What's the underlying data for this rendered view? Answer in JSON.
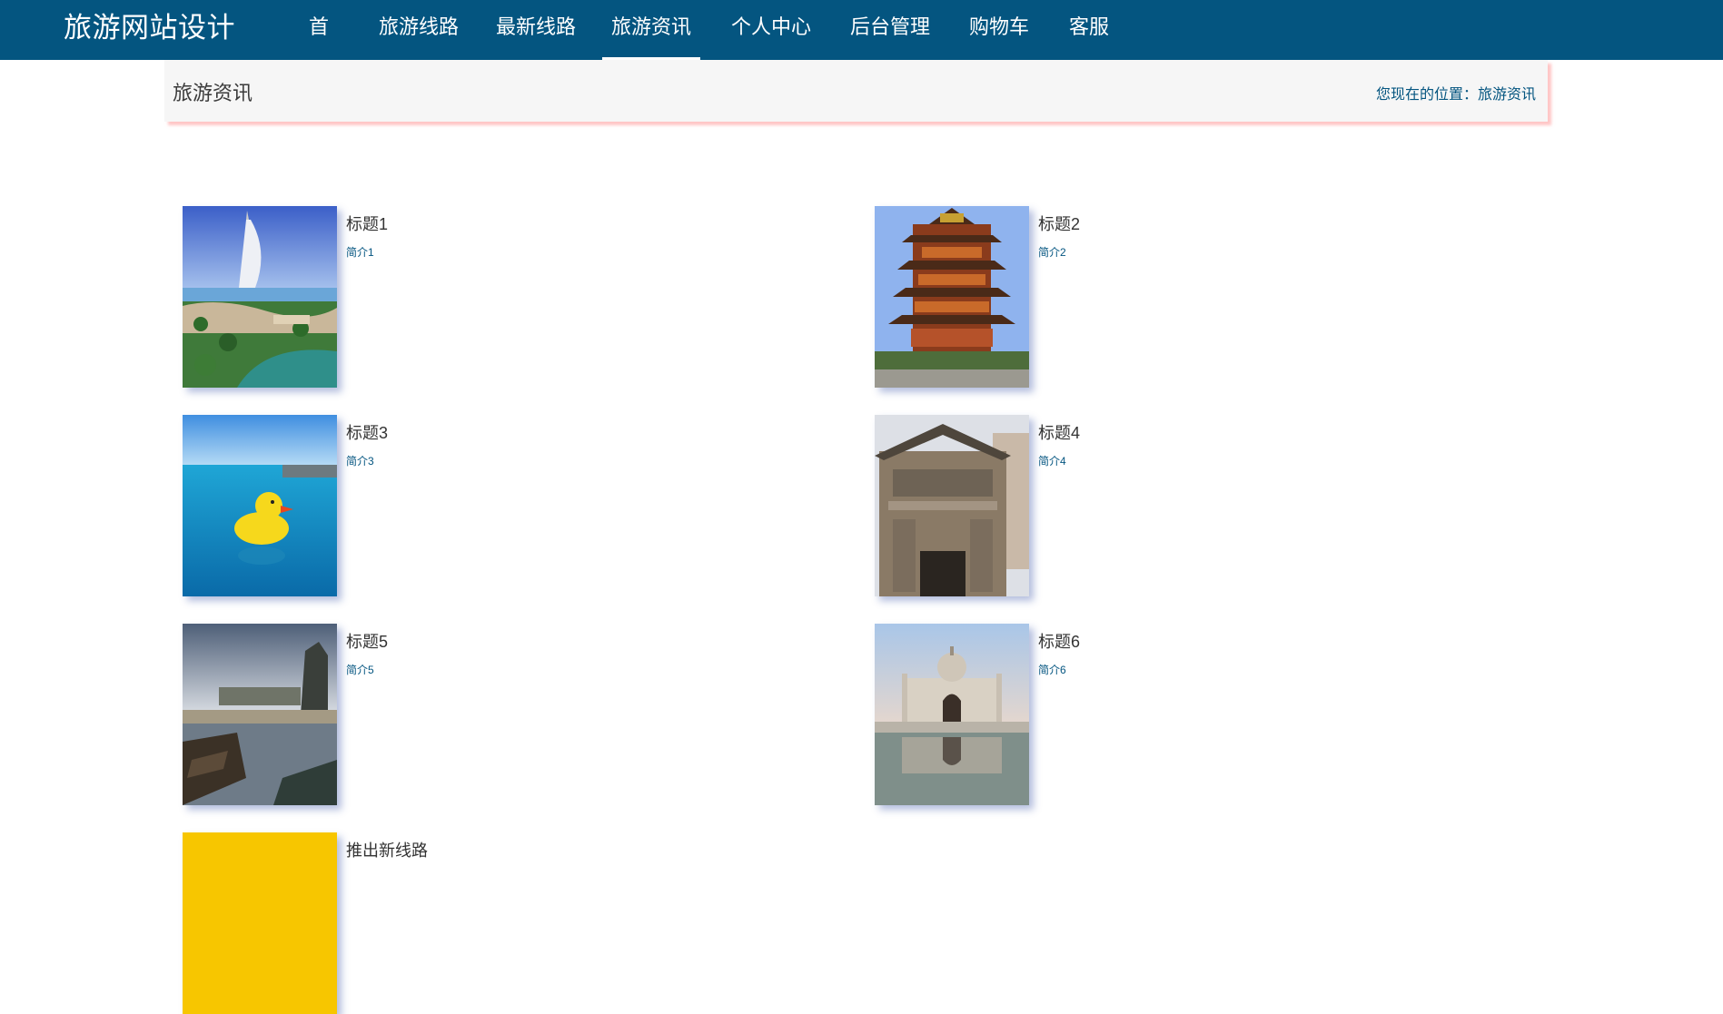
{
  "navbar": {
    "brand": "旅游网站设计",
    "items": [
      {
        "label": "首页"
      },
      {
        "label": "旅游线路"
      },
      {
        "label": "最新线路"
      },
      {
        "label": "旅游资讯"
      },
      {
        "label": "个人中心"
      },
      {
        "label": "后台管理"
      },
      {
        "label": "购物车"
      },
      {
        "label": "客服"
      }
    ],
    "active_index": 3
  },
  "header": {
    "title": "旅游资讯",
    "breadcrumb": "您现在的位置：旅游资讯"
  },
  "articles": [
    {
      "title": "标题1",
      "summary": "简介1",
      "image": "burj-al-arab-resort"
    },
    {
      "title": "标题2",
      "summary": "简介2",
      "image": "yellow-crane-tower"
    },
    {
      "title": "标题3",
      "summary": "简介3",
      "image": "rubber-duck-pool"
    },
    {
      "title": "标题4",
      "summary": "简介4",
      "image": "stone-archway"
    },
    {
      "title": "标题5",
      "summary": "简介5",
      "image": "lake-boats-pagoda"
    },
    {
      "title": "标题6",
      "summary": "简介6",
      "image": "domed-palace-reflection"
    },
    {
      "title": "推出新线路",
      "summary": "",
      "image": "yellow-banner"
    }
  ],
  "colors": {
    "navbar_bg": "#045580",
    "link": "#045580"
  }
}
